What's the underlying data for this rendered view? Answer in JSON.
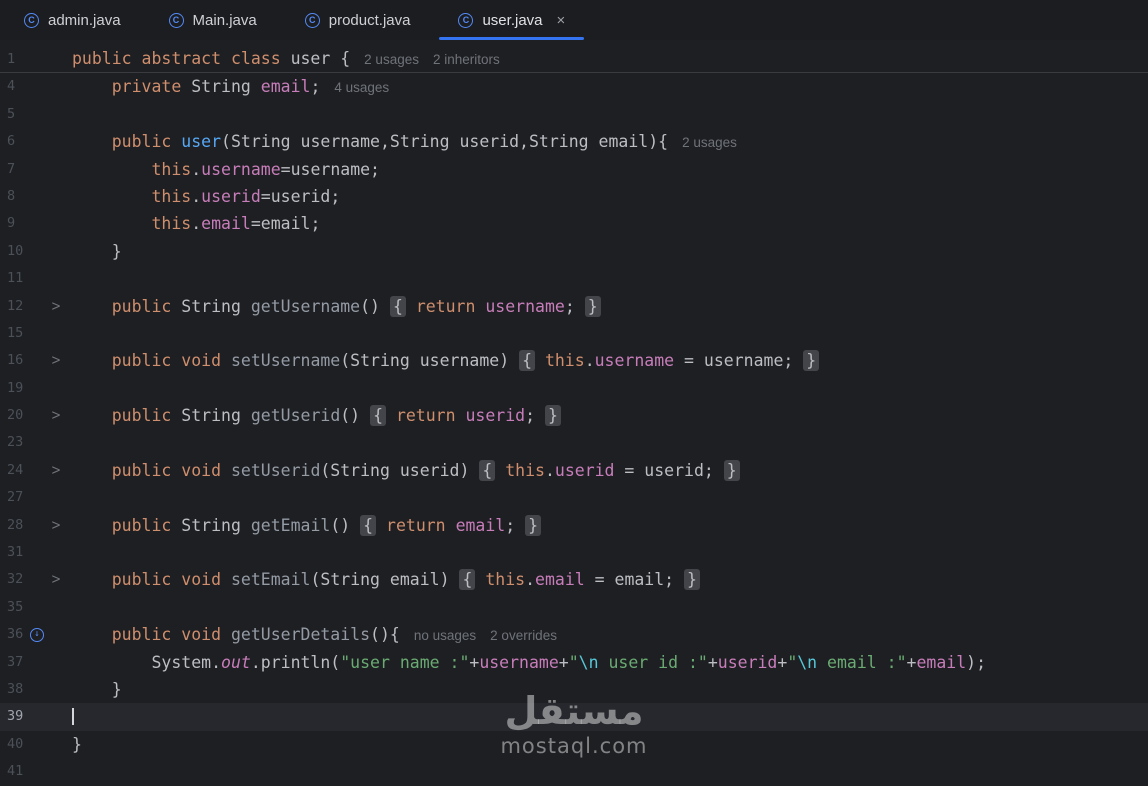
{
  "colors": {
    "bg": "#1e1f22",
    "tabbar_bg": "#1b1d20",
    "accent": "#3574f0",
    "tab_text": "#ced0d6",
    "tab_text_active": "#dfe1e5",
    "tab_close": "#9da0a8",
    "icon_blue": "#548af7",
    "kw": "#cf8e6d",
    "plain": "#bcbec4",
    "field": "#c77dba",
    "mdecl": "#56a8f5",
    "mgray": "#949ba5",
    "str": "#6aab73",
    "esc": "#56c8d8",
    "hint": "#6f737a",
    "fold_bg": "#43454a",
    "gutter": "#4b5059",
    "gutter_active": "#a1a5ad",
    "currentline": "#26282e",
    "sticky_border": "#393b40",
    "caret": "#d4d6da",
    "watermark": "rgba(214,214,214,0.55)"
  },
  "icons": {
    "java_class": "C",
    "fold_chevron": ">",
    "override_arrow": "↓",
    "close": "×"
  },
  "tabs": [
    {
      "label": "admin.java",
      "active": false
    },
    {
      "label": "Main.java",
      "active": false
    },
    {
      "label": "product.java",
      "active": false
    },
    {
      "label": "user.java",
      "active": true,
      "close": "×"
    }
  ],
  "editor": {
    "lines": [
      {
        "num": "1",
        "sticky": true,
        "tokens": [
          [
            "kw",
            "public "
          ],
          [
            "kw",
            "abstract "
          ],
          [
            "kw",
            "class "
          ],
          [
            "plain",
            "user "
          ],
          [
            "plain",
            "{"
          ]
        ],
        "hints": [
          "2 usages",
          "2 inheritors"
        ]
      },
      {
        "num": "4",
        "tokens": [
          [
            "plain",
            "    "
          ],
          [
            "kw",
            "private "
          ],
          [
            "plain",
            "String "
          ],
          [
            "field",
            "email"
          ],
          [
            "plain",
            ";"
          ]
        ],
        "hints": [
          "4 usages"
        ]
      },
      {
        "num": "5",
        "tokens": []
      },
      {
        "num": "6",
        "tokens": [
          [
            "plain",
            "    "
          ],
          [
            "kw",
            "public "
          ],
          [
            "mdecl",
            "user"
          ],
          [
            "plain",
            "(String username,String userid,String email){"
          ]
        ],
        "hints": [
          "2 usages"
        ]
      },
      {
        "num": "7",
        "tokens": [
          [
            "plain",
            "        "
          ],
          [
            "kw",
            "this"
          ],
          [
            "plain",
            "."
          ],
          [
            "field",
            "username"
          ],
          [
            "plain",
            "=username;"
          ]
        ]
      },
      {
        "num": "8",
        "tokens": [
          [
            "plain",
            "        "
          ],
          [
            "kw",
            "this"
          ],
          [
            "plain",
            "."
          ],
          [
            "field",
            "userid"
          ],
          [
            "plain",
            "=userid;"
          ]
        ]
      },
      {
        "num": "9",
        "tokens": [
          [
            "plain",
            "        "
          ],
          [
            "kw",
            "this"
          ],
          [
            "plain",
            "."
          ],
          [
            "field",
            "email"
          ],
          [
            "plain",
            "=email;"
          ]
        ]
      },
      {
        "num": "10",
        "tokens": [
          [
            "plain",
            "    }"
          ]
        ]
      },
      {
        "num": "11",
        "tokens": []
      },
      {
        "num": "12",
        "fold": true,
        "tokens": [
          [
            "plain",
            "    "
          ],
          [
            "kw",
            "public "
          ],
          [
            "plain",
            "String "
          ],
          [
            "mgray",
            "getUsername"
          ],
          [
            "plain",
            "() "
          ],
          [
            "fold",
            "{"
          ],
          [
            "plain",
            " "
          ],
          [
            "kw",
            "return "
          ],
          [
            "field",
            "username"
          ],
          [
            "plain",
            "; "
          ],
          [
            "fold",
            "}"
          ]
        ]
      },
      {
        "num": "15",
        "tokens": []
      },
      {
        "num": "16",
        "fold": true,
        "tokens": [
          [
            "plain",
            "    "
          ],
          [
            "kw",
            "public "
          ],
          [
            "kw",
            "void "
          ],
          [
            "mgray",
            "setUsername"
          ],
          [
            "plain",
            "(String username) "
          ],
          [
            "fold",
            "{"
          ],
          [
            "plain",
            " "
          ],
          [
            "kw",
            "this"
          ],
          [
            "plain",
            "."
          ],
          [
            "field",
            "username"
          ],
          [
            "plain",
            " = username; "
          ],
          [
            "fold",
            "}"
          ]
        ]
      },
      {
        "num": "19",
        "tokens": []
      },
      {
        "num": "20",
        "fold": true,
        "tokens": [
          [
            "plain",
            "    "
          ],
          [
            "kw",
            "public "
          ],
          [
            "plain",
            "String "
          ],
          [
            "mgray",
            "getUserid"
          ],
          [
            "plain",
            "() "
          ],
          [
            "fold",
            "{"
          ],
          [
            "plain",
            " "
          ],
          [
            "kw",
            "return "
          ],
          [
            "field",
            "userid"
          ],
          [
            "plain",
            "; "
          ],
          [
            "fold",
            "}"
          ]
        ]
      },
      {
        "num": "23",
        "tokens": []
      },
      {
        "num": "24",
        "fold": true,
        "tokens": [
          [
            "plain",
            "    "
          ],
          [
            "kw",
            "public "
          ],
          [
            "kw",
            "void "
          ],
          [
            "mgray",
            "setUserid"
          ],
          [
            "plain",
            "(String userid) "
          ],
          [
            "fold",
            "{"
          ],
          [
            "plain",
            " "
          ],
          [
            "kw",
            "this"
          ],
          [
            "plain",
            "."
          ],
          [
            "field",
            "userid"
          ],
          [
            "plain",
            " = userid; "
          ],
          [
            "fold",
            "}"
          ]
        ]
      },
      {
        "num": "27",
        "tokens": []
      },
      {
        "num": "28",
        "fold": true,
        "tokens": [
          [
            "plain",
            "    "
          ],
          [
            "kw",
            "public "
          ],
          [
            "plain",
            "String "
          ],
          [
            "mgray",
            "getEmail"
          ],
          [
            "plain",
            "() "
          ],
          [
            "fold",
            "{"
          ],
          [
            "plain",
            " "
          ],
          [
            "kw",
            "return "
          ],
          [
            "field",
            "email"
          ],
          [
            "plain",
            "; "
          ],
          [
            "fold",
            "}"
          ]
        ]
      },
      {
        "num": "31",
        "tokens": []
      },
      {
        "num": "32",
        "fold": true,
        "tokens": [
          [
            "plain",
            "    "
          ],
          [
            "kw",
            "public "
          ],
          [
            "kw",
            "void "
          ],
          [
            "mgray",
            "setEmail"
          ],
          [
            "plain",
            "(String email) "
          ],
          [
            "fold",
            "{"
          ],
          [
            "plain",
            " "
          ],
          [
            "kw",
            "this"
          ],
          [
            "plain",
            "."
          ],
          [
            "field",
            "email"
          ],
          [
            "plain",
            " = email; "
          ],
          [
            "fold",
            "}"
          ]
        ]
      },
      {
        "num": "35",
        "tokens": []
      },
      {
        "num": "36",
        "icon": "override",
        "tokens": [
          [
            "plain",
            "    "
          ],
          [
            "kw",
            "public "
          ],
          [
            "kw",
            "void "
          ],
          [
            "mgray",
            "getUserDetails"
          ],
          [
            "plain",
            "(){"
          ]
        ],
        "hints": [
          "no usages",
          "2 overrides"
        ]
      },
      {
        "num": "37",
        "tokens": [
          [
            "plain",
            "        System."
          ],
          [
            "sfield",
            "out"
          ],
          [
            "plain",
            ".println("
          ],
          [
            "str",
            "\"user name :\""
          ],
          [
            "plain",
            "+"
          ],
          [
            "field",
            "username"
          ],
          [
            "plain",
            "+"
          ],
          [
            "str",
            "\""
          ],
          [
            "esc",
            "\\n"
          ],
          [
            "str",
            " user id :\""
          ],
          [
            "plain",
            "+"
          ],
          [
            "field",
            "userid"
          ],
          [
            "plain",
            "+"
          ],
          [
            "str",
            "\""
          ],
          [
            "esc",
            "\\n"
          ],
          [
            "str",
            " email :\""
          ],
          [
            "plain",
            "+"
          ],
          [
            "field",
            "email"
          ],
          [
            "plain",
            ");"
          ]
        ]
      },
      {
        "num": "38",
        "tokens": [
          [
            "plain",
            "    }"
          ]
        ]
      },
      {
        "num": "39",
        "current": true,
        "caret": true,
        "tokens": []
      },
      {
        "num": "40",
        "tokens": [
          [
            "plain",
            "}"
          ]
        ]
      },
      {
        "num": "41",
        "tokens": []
      }
    ]
  },
  "watermark": {
    "arabic": "مستقل",
    "latin": "mostaql.com"
  }
}
